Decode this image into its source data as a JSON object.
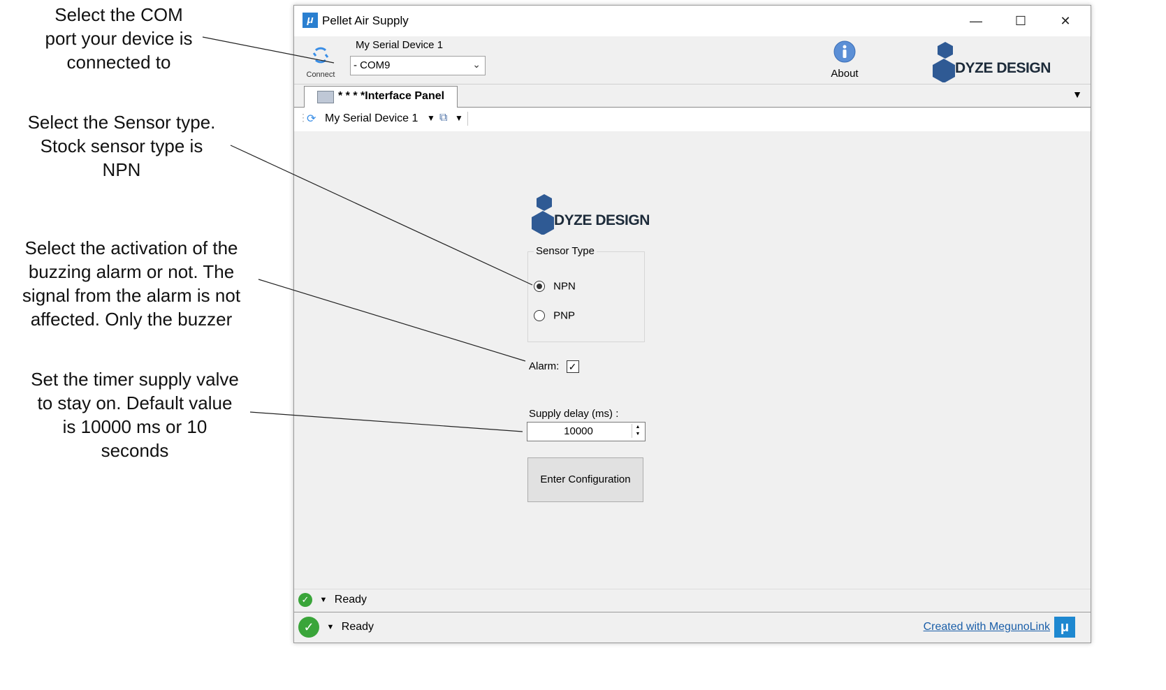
{
  "annotations": {
    "com_port": "Select the COM\nport your device is\nconnected to",
    "sensor_type": "Select the Sensor type.\nStock sensor type is\nNPN",
    "alarm": "Select the activation of the\nbuzzing alarm or not. The\nsignal from the alarm is not\naffected. Only the buzzer",
    "timer": "Set the timer supply valve\nto stay on. Default value\nis 10000 ms or 10\nseconds"
  },
  "window": {
    "app_icon": "μ",
    "title": "Pellet Air Supply",
    "controls": {
      "minimize": "—",
      "maximize": "☐",
      "close": "✕"
    }
  },
  "toolbar": {
    "connect_label": "Connect",
    "device_label": "My Serial Device 1",
    "com_port_value": "- COM9",
    "about_label": "About",
    "brand_text": "DYZE DESIGN"
  },
  "tabs": [
    {
      "label": "* * * *Interface Panel"
    }
  ],
  "panel_toolbar": {
    "device": "My Serial Device 1"
  },
  "panel": {
    "logo_text": "DYZE DESIGN",
    "sensor_type": {
      "legend": "Sensor Type",
      "options": [
        "NPN",
        "PNP"
      ],
      "selected": "NPN"
    },
    "alarm": {
      "label": "Alarm:",
      "checked": true
    },
    "supply_delay": {
      "label": "Supply delay (ms) :",
      "value": "10000"
    },
    "enter_button": "Enter Configuration"
  },
  "status": {
    "inner_text": "Ready",
    "outer_text": "Ready",
    "credit": "Created with MegunoLink"
  },
  "colors": {
    "brand_blue": "#2f5a94",
    "status_green": "#3aa53a",
    "link_blue": "#1a5ea8"
  },
  "icons": {
    "connect": "connect-icon",
    "about": "info-icon",
    "ok": "check-icon",
    "megunolink": "megunolink-icon"
  }
}
